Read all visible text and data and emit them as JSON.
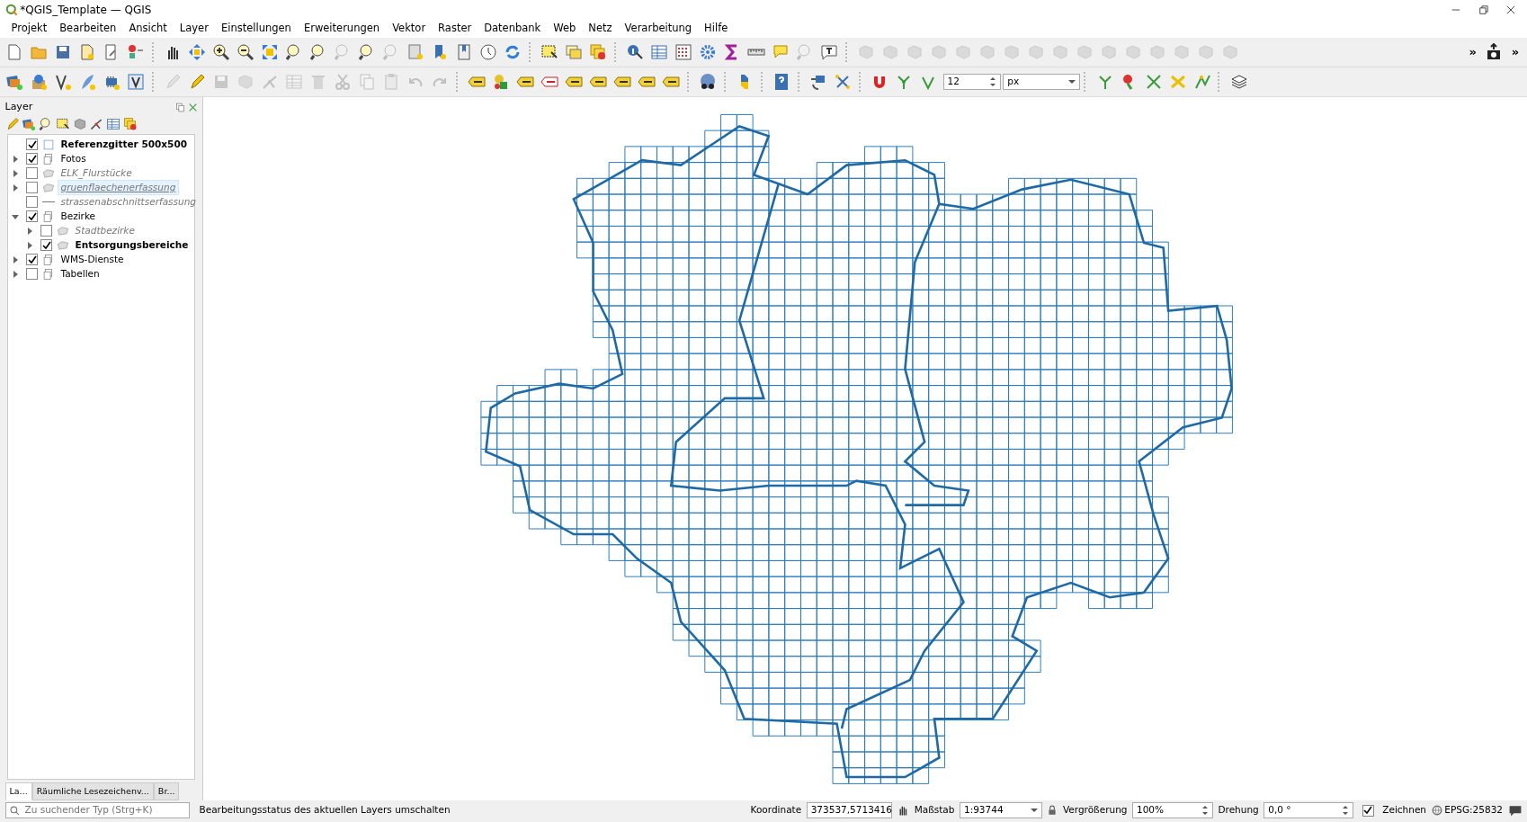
{
  "window": {
    "title": "*QGIS_Template — QGIS"
  },
  "menu": [
    "Projekt",
    "Bearbeiten",
    "Ansicht",
    "Layer",
    "Einstellungen",
    "Erweiterungen",
    "Vektor",
    "Raster",
    "Datenbank",
    "Web",
    "Netz",
    "Verarbeitung",
    "Hilfe"
  ],
  "toolbars": [
    {
      "groups": [
        {
          "disabled": [
            false,
            false,
            false,
            false,
            false,
            false
          ]
        },
        {
          "disabled": [
            false,
            false,
            false,
            false,
            false,
            false,
            false,
            true,
            false,
            true,
            false,
            false,
            false,
            false,
            false
          ]
        },
        {
          "disabled": [
            false,
            false,
            false
          ]
        },
        {
          "disabled": [
            false,
            false,
            false,
            false,
            false,
            false,
            false,
            true,
            false
          ]
        },
        {
          "disabled": [
            true,
            true,
            true,
            true,
            true,
            true,
            true,
            true,
            true,
            true,
            true,
            true,
            true,
            true,
            true,
            true
          ]
        },
        {
          "disabled": [
            false
          ]
        }
      ],
      "more_buttons": [
        "»",
        "»"
      ]
    },
    {
      "groups": [
        {
          "disabled": [
            false,
            false,
            false,
            false,
            false,
            false
          ]
        },
        {
          "disabled": [
            true,
            false,
            true,
            true,
            true,
            true,
            true,
            true,
            true,
            true,
            true,
            true
          ]
        },
        {
          "disabled": [
            false,
            false,
            false,
            false,
            false,
            false,
            false,
            false,
            false
          ]
        },
        {
          "disabled": [
            false
          ]
        },
        {
          "disabled": [
            false
          ]
        },
        {
          "disabled": [
            false
          ]
        },
        {
          "disabled": [
            false,
            false
          ]
        },
        {
          "disabled": [
            false,
            false,
            false
          ]
        },
        {
          "disabled": [
            false,
            false,
            false,
            false,
            false
          ]
        },
        {
          "disabled": [
            false
          ]
        }
      ],
      "tolerance": {
        "value": "12",
        "unit": "px"
      }
    }
  ],
  "layer_panel": {
    "title": "Layer",
    "layers": [
      {
        "label": "Referenzgitter 500x500",
        "kind": "grid",
        "checked": true,
        "bold": true,
        "inactive": false,
        "selected": false
      },
      {
        "label": "Fotos",
        "kind": "group",
        "checked": true,
        "bold": false,
        "inactive": false,
        "selected": false,
        "expanded": false
      },
      {
        "label": "ELK_Flurstücke",
        "kind": "polygon",
        "checked": false,
        "bold": false,
        "inactive": true,
        "selected": false,
        "expanded": false
      },
      {
        "label": "gruenflaechenerfassung",
        "kind": "polygon",
        "checked": false,
        "bold": false,
        "inactive": true,
        "selected": true,
        "expanded": false
      },
      {
        "label": "strassenabschnittserfassung",
        "kind": "line",
        "checked": false,
        "bold": false,
        "inactive": true,
        "selected": false
      },
      {
        "label": "Bezirke",
        "kind": "group",
        "checked": true,
        "bold": false,
        "inactive": false,
        "selected": false,
        "expanded": true,
        "children": [
          {
            "label": "Stadtbezirke",
            "kind": "polygon",
            "checked": false,
            "bold": false,
            "inactive": true,
            "selected": false,
            "expanded": false
          },
          {
            "label": "Entsorgungsbereiche",
            "kind": "polygon",
            "checked": true,
            "bold": true,
            "inactive": false,
            "selected": false,
            "expanded": false
          }
        ]
      },
      {
        "label": "WMS-Dienste",
        "kind": "group",
        "checked": true,
        "bold": false,
        "inactive": false,
        "selected": false,
        "expanded": false
      },
      {
        "label": "Tabellen",
        "kind": "group",
        "checked": false,
        "bold": false,
        "inactive": false,
        "selected": false,
        "expanded": false
      }
    ],
    "tabs": [
      {
        "label": "La...",
        "selected": true
      },
      {
        "label": "Räumliche Lesezeichenv...",
        "selected": false
      },
      {
        "label": "Br...",
        "selected": false
      }
    ]
  },
  "status_bar": {
    "search_placeholder": "Zu suchender Typ (Strg+K)",
    "message": "Bearbeitungsstatus des aktuellen Layers umschalten",
    "coordinate_label": "Koordinate",
    "coordinate": "373537,5713416",
    "scale_label": "Maßstab",
    "scale": "1:93744",
    "magnifier_label": "Vergrößerung",
    "magnifier": "100%",
    "rotation_label": "Drehung",
    "rotation": "0,0 °",
    "render_label": "Zeichnen",
    "render_checked": true,
    "crs": "EPSG:25832"
  }
}
